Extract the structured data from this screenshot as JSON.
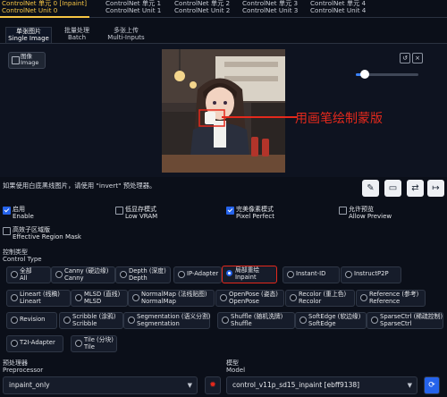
{
  "units": [
    {
      "l1": "ControlNet 单元 0",
      "l1b": "[Inpaint]",
      "l2": "ControlNet Unit 0"
    },
    {
      "l1": "ControlNet 单元 1",
      "l2": "ControlNet Unit 1"
    },
    {
      "l1": "ControlNet 单元 2",
      "l2": "ControlNet Unit 2"
    },
    {
      "l1": "ControlNet 单元 3",
      "l2": "ControlNet Unit 3"
    },
    {
      "l1": "ControlNet 单元 4",
      "l2": "ControlNet Unit 4"
    }
  ],
  "subtabs": [
    {
      "cn": "单张图片",
      "en": "Single Image"
    },
    {
      "cn": "批量处理",
      "en": "Batch"
    },
    {
      "cn": "多张上传",
      "en": "Multi-Inputs"
    }
  ],
  "upload": {
    "cn": "图像",
    "en": "Image"
  },
  "annotation": "用画笔绘制蒙版",
  "hint": "如果使用白底黑线图片，请使用 \"invert\" 预处理器。",
  "checks": [
    {
      "cn": "启用",
      "en": "Enable",
      "on": true
    },
    {
      "cn": "低显存模式",
      "en": "Low VRAM",
      "on": false
    },
    {
      "cn": "完美像素模式",
      "en": "Pixel Perfect",
      "on": true
    },
    {
      "cn": "允许预览",
      "en": "Allow Preview",
      "on": false
    },
    {
      "cn": "高效子区域版",
      "en": "Effective Region Mask",
      "on": false
    }
  ],
  "control_type_label": {
    "cn": "控制类型",
    "en": "Control Type"
  },
  "control_types": [
    {
      "cn": "全部",
      "en": "All"
    },
    {
      "cn": "Canny (硬边缘)",
      "en": "Canny"
    },
    {
      "cn": "Depth (深度)",
      "en": "Depth"
    },
    {
      "cn": "IP-Adapter",
      "en": ""
    },
    {
      "cn": "局部重绘",
      "en": "Inpaint"
    },
    {
      "cn": "Instant-ID",
      "en": ""
    },
    {
      "cn": "InstructP2P",
      "en": ""
    },
    {
      "cn": "Lineart (线稿)",
      "en": "Lineart"
    },
    {
      "cn": "MLSD (直线)",
      "en": "MLSD"
    },
    {
      "cn": "NormalMap (法线贴图)",
      "en": "NormalMap"
    },
    {
      "cn": "OpenPose (姿态)",
      "en": "OpenPose"
    },
    {
      "cn": "Recolor (重上色)",
      "en": "Recolor"
    },
    {
      "cn": "Reference (参考)",
      "en": "Reference"
    },
    {
      "cn": "Revision",
      "en": ""
    },
    {
      "cn": "Scribble (涂鸦)",
      "en": "Scribble"
    },
    {
      "cn": "Segmentation (语义分割)",
      "en": "Segmentation"
    },
    {
      "cn": "Shuffle (随机洗牌)",
      "en": "Shuffle"
    },
    {
      "cn": "SoftEdge (软边缘)",
      "en": "SoftEdge"
    },
    {
      "cn": "SparseCtrl (稀疏控制)",
      "en": "SparseCtrl"
    },
    {
      "cn": "T2I-Adapter",
      "en": ""
    },
    {
      "cn": "Tile (分块)",
      "en": "Tile"
    }
  ],
  "selected_control": "Inpaint",
  "preprocessor": {
    "cn": "预处理器",
    "en": "Preprocessor",
    "value": "inpaint_only"
  },
  "model": {
    "cn": "模型",
    "en": "Model",
    "value": "control_v11p_sd15_inpaint [ebff9138]"
  },
  "colors": {
    "accent": "#f6c544",
    "highlight": "#e4291c",
    "checked": "#2563eb"
  }
}
